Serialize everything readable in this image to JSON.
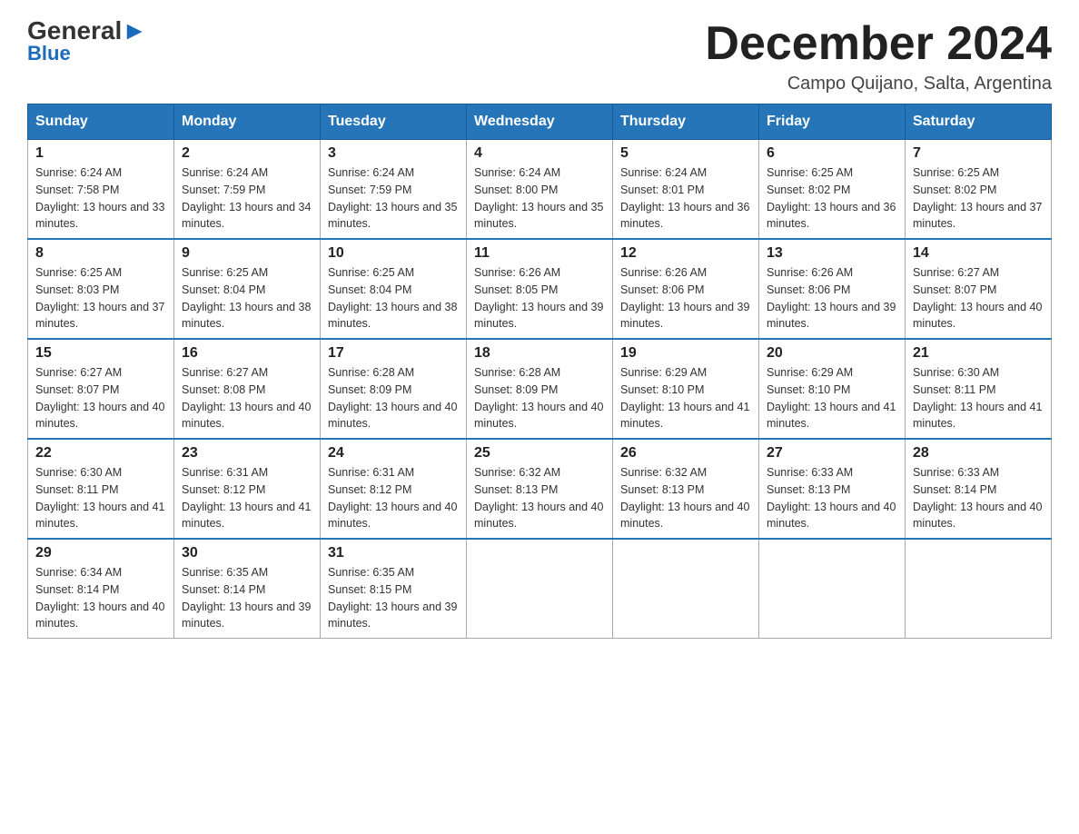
{
  "header": {
    "logo_general": "General",
    "logo_blue": "Blue",
    "month_title": "December 2024",
    "location": "Campo Quijano, Salta, Argentina"
  },
  "days_of_week": [
    "Sunday",
    "Monday",
    "Tuesday",
    "Wednesday",
    "Thursday",
    "Friday",
    "Saturday"
  ],
  "weeks": [
    [
      {
        "day": "1",
        "sunrise": "6:24 AM",
        "sunset": "7:58 PM",
        "daylight": "13 hours and 33 minutes."
      },
      {
        "day": "2",
        "sunrise": "6:24 AM",
        "sunset": "7:59 PM",
        "daylight": "13 hours and 34 minutes."
      },
      {
        "day": "3",
        "sunrise": "6:24 AM",
        "sunset": "7:59 PM",
        "daylight": "13 hours and 35 minutes."
      },
      {
        "day": "4",
        "sunrise": "6:24 AM",
        "sunset": "8:00 PM",
        "daylight": "13 hours and 35 minutes."
      },
      {
        "day": "5",
        "sunrise": "6:24 AM",
        "sunset": "8:01 PM",
        "daylight": "13 hours and 36 minutes."
      },
      {
        "day": "6",
        "sunrise": "6:25 AM",
        "sunset": "8:02 PM",
        "daylight": "13 hours and 36 minutes."
      },
      {
        "day": "7",
        "sunrise": "6:25 AM",
        "sunset": "8:02 PM",
        "daylight": "13 hours and 37 minutes."
      }
    ],
    [
      {
        "day": "8",
        "sunrise": "6:25 AM",
        "sunset": "8:03 PM",
        "daylight": "13 hours and 37 minutes."
      },
      {
        "day": "9",
        "sunrise": "6:25 AM",
        "sunset": "8:04 PM",
        "daylight": "13 hours and 38 minutes."
      },
      {
        "day": "10",
        "sunrise": "6:25 AM",
        "sunset": "8:04 PM",
        "daylight": "13 hours and 38 minutes."
      },
      {
        "day": "11",
        "sunrise": "6:26 AM",
        "sunset": "8:05 PM",
        "daylight": "13 hours and 39 minutes."
      },
      {
        "day": "12",
        "sunrise": "6:26 AM",
        "sunset": "8:06 PM",
        "daylight": "13 hours and 39 minutes."
      },
      {
        "day": "13",
        "sunrise": "6:26 AM",
        "sunset": "8:06 PM",
        "daylight": "13 hours and 39 minutes."
      },
      {
        "day": "14",
        "sunrise": "6:27 AM",
        "sunset": "8:07 PM",
        "daylight": "13 hours and 40 minutes."
      }
    ],
    [
      {
        "day": "15",
        "sunrise": "6:27 AM",
        "sunset": "8:07 PM",
        "daylight": "13 hours and 40 minutes."
      },
      {
        "day": "16",
        "sunrise": "6:27 AM",
        "sunset": "8:08 PM",
        "daylight": "13 hours and 40 minutes."
      },
      {
        "day": "17",
        "sunrise": "6:28 AM",
        "sunset": "8:09 PM",
        "daylight": "13 hours and 40 minutes."
      },
      {
        "day": "18",
        "sunrise": "6:28 AM",
        "sunset": "8:09 PM",
        "daylight": "13 hours and 40 minutes."
      },
      {
        "day": "19",
        "sunrise": "6:29 AM",
        "sunset": "8:10 PM",
        "daylight": "13 hours and 41 minutes."
      },
      {
        "day": "20",
        "sunrise": "6:29 AM",
        "sunset": "8:10 PM",
        "daylight": "13 hours and 41 minutes."
      },
      {
        "day": "21",
        "sunrise": "6:30 AM",
        "sunset": "8:11 PM",
        "daylight": "13 hours and 41 minutes."
      }
    ],
    [
      {
        "day": "22",
        "sunrise": "6:30 AM",
        "sunset": "8:11 PM",
        "daylight": "13 hours and 41 minutes."
      },
      {
        "day": "23",
        "sunrise": "6:31 AM",
        "sunset": "8:12 PM",
        "daylight": "13 hours and 41 minutes."
      },
      {
        "day": "24",
        "sunrise": "6:31 AM",
        "sunset": "8:12 PM",
        "daylight": "13 hours and 40 minutes."
      },
      {
        "day": "25",
        "sunrise": "6:32 AM",
        "sunset": "8:13 PM",
        "daylight": "13 hours and 40 minutes."
      },
      {
        "day": "26",
        "sunrise": "6:32 AM",
        "sunset": "8:13 PM",
        "daylight": "13 hours and 40 minutes."
      },
      {
        "day": "27",
        "sunrise": "6:33 AM",
        "sunset": "8:13 PM",
        "daylight": "13 hours and 40 minutes."
      },
      {
        "day": "28",
        "sunrise": "6:33 AM",
        "sunset": "8:14 PM",
        "daylight": "13 hours and 40 minutes."
      }
    ],
    [
      {
        "day": "29",
        "sunrise": "6:34 AM",
        "sunset": "8:14 PM",
        "daylight": "13 hours and 40 minutes."
      },
      {
        "day": "30",
        "sunrise": "6:35 AM",
        "sunset": "8:14 PM",
        "daylight": "13 hours and 39 minutes."
      },
      {
        "day": "31",
        "sunrise": "6:35 AM",
        "sunset": "8:15 PM",
        "daylight": "13 hours and 39 minutes."
      },
      null,
      null,
      null,
      null
    ]
  ]
}
